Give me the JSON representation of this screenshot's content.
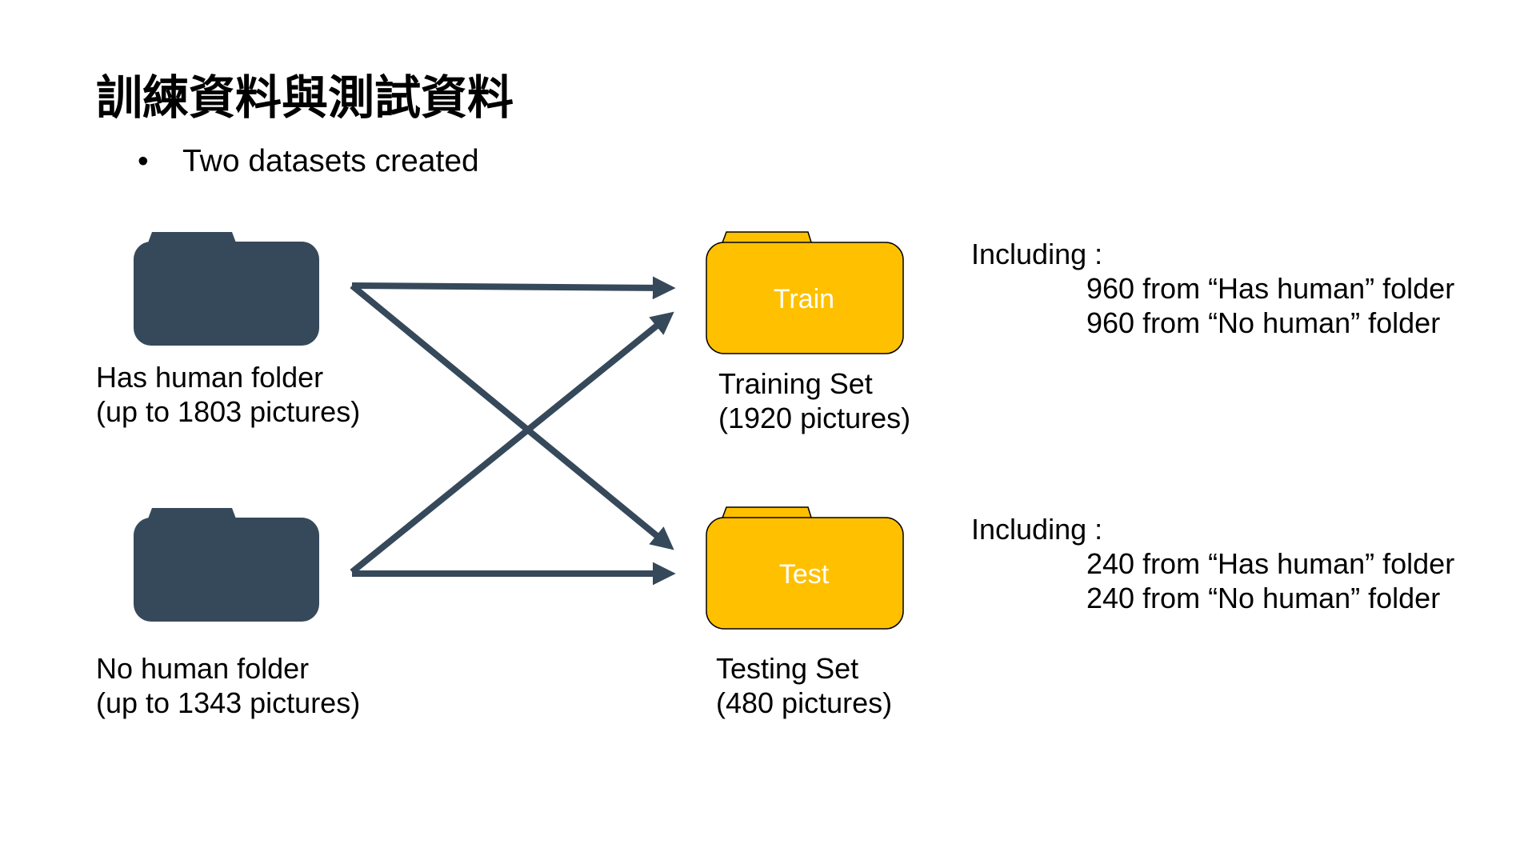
{
  "title": "訓練資料與測試資料",
  "bullets": [
    "Two datasets created"
  ],
  "folders": {
    "has_human": {
      "line1": "Has human folder",
      "line2": "(up to 1803 pictures)",
      "color": "#36495A"
    },
    "no_human": {
      "line1": "No human folder",
      "line2": "(up to 1343 pictures)",
      "color": "#36495A"
    },
    "train": {
      "folder_label": "Train",
      "line1": "Training Set",
      "line2": "(1920 pictures)",
      "color": "#FFC000"
    },
    "test": {
      "folder_label": "Test",
      "line1": "Testing Set",
      "line2": "(480 pictures)",
      "color": "#FFC000"
    }
  },
  "train_info": {
    "heading": "Including :",
    "items": [
      "960 from “Has human” folder",
      "960 from “No human” folder"
    ]
  },
  "test_info": {
    "heading": "Including :",
    "items": [
      "240 from “Has human” folder",
      "240 from “No human” folder"
    ]
  },
  "arrow_color": "#36495A"
}
